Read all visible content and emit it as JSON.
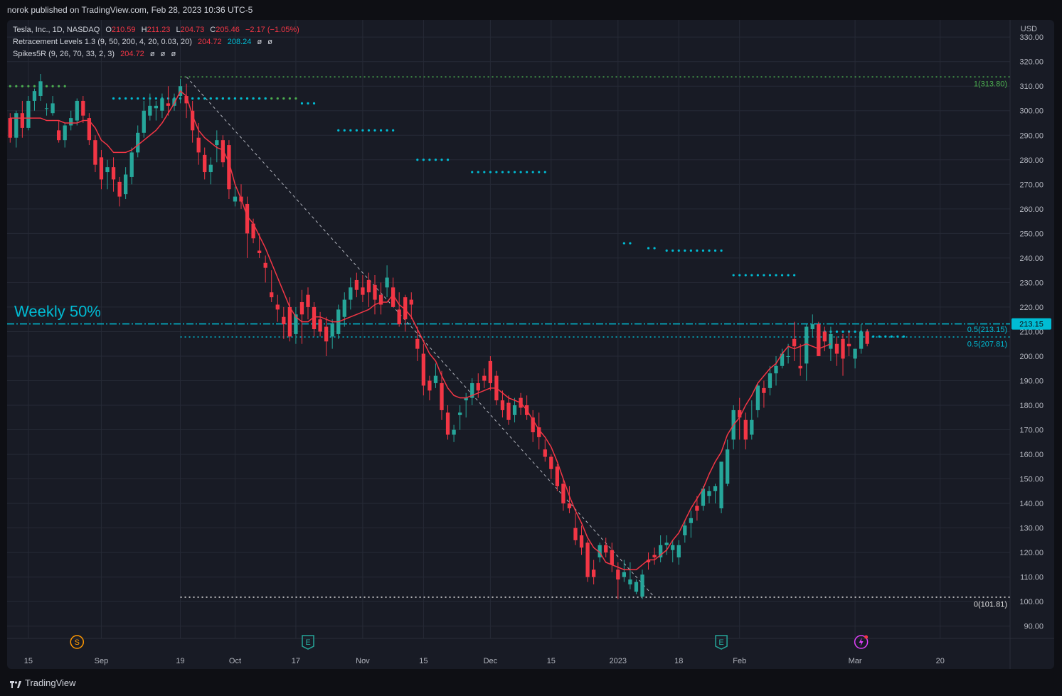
{
  "header": {
    "publish_line": "norok published on TradingView.com, Feb 28, 2023 10:36 UTC-5"
  },
  "legend": {
    "symbol": "Tesla, Inc., 1D, NASDAQ",
    "o_label": "O",
    "o_value": "210.59",
    "h_label": "H",
    "h_value": "211.23",
    "l_label": "L",
    "l_value": "204.73",
    "c_label": "C",
    "c_value": "205.46",
    "change": "−2.17 (−1.05%)",
    "ind1_name": "Retracement Levels 1.3 (9, 50, 200, 4, 20, 0.03, 20)",
    "ind1_v1": "204.72",
    "ind1_v2": "208.24",
    "ind1_v3": "ø",
    "ind1_v4": "ø",
    "ind2_name": "Spikes5R (9, 26, 70, 33, 2, 3)",
    "ind2_v1": "204.72",
    "ind2_v2": "ø",
    "ind2_v3": "ø",
    "ind2_v4": "ø"
  },
  "currency": "USD",
  "annotation": "Weekly 50%",
  "level_labels": {
    "top": "1(313.80)",
    "half_upper": "0.5(213.15)",
    "half_lower": "0.5(207.81)",
    "bottom": "0(101.81)"
  },
  "price_tag": "213.15",
  "event_markers": [
    "S",
    "E",
    "E"
  ],
  "footer": {
    "brand": "TradingView"
  },
  "colors": {
    "up": "#26a69a",
    "down": "#f23645",
    "cyan": "#00bcd4",
    "green_dots": "#4caf50",
    "bg": "#181b25",
    "grid": "#262a36",
    "text": "#b2b5be"
  },
  "chart_data": {
    "type": "candlestick",
    "title": "Tesla, Inc., 1D, NASDAQ",
    "y_axis": {
      "ticks": [
        90,
        100,
        110,
        120,
        130,
        140,
        150,
        160,
        170,
        180,
        190,
        200,
        210,
        220,
        230,
        240,
        250,
        260,
        270,
        280,
        290,
        300,
        310,
        320,
        330
      ],
      "ylim": [
        85,
        337
      ]
    },
    "x_axis": {
      "tick_labels": [
        {
          "label": "15",
          "i": 3
        },
        {
          "label": "Sep",
          "i": 15
        },
        {
          "label": "19",
          "i": 28
        },
        {
          "label": "Oct",
          "i": 37
        },
        {
          "label": "17",
          "i": 47
        },
        {
          "label": "Nov",
          "i": 58
        },
        {
          "label": "15",
          "i": 68
        },
        {
          "label": "Dec",
          "i": 79
        },
        {
          "label": "15",
          "i": 89
        },
        {
          "label": "2023",
          "i": 100
        },
        {
          "label": "18",
          "i": 110
        },
        {
          "label": "Feb",
          "i": 120
        },
        {
          "label": "Mar",
          "i": 139
        },
        {
          "label": "20",
          "i": 153
        }
      ],
      "total_slots": 165
    },
    "candles": [
      [
        297,
        299,
        287,
        289
      ],
      [
        289,
        300,
        285,
        299
      ],
      [
        299,
        304,
        289,
        293
      ],
      [
        293,
        306,
        292,
        304
      ],
      [
        304,
        309,
        300,
        308
      ],
      [
        306,
        315,
        304,
        312
      ],
      [
        301,
        303,
        298,
        301
      ],
      [
        299,
        306,
        298,
        303
      ],
      [
        292,
        296,
        287,
        288
      ],
      [
        288,
        295,
        285,
        294
      ],
      [
        294,
        300,
        292,
        297
      ],
      [
        296,
        305,
        294,
        304
      ],
      [
        304,
        306,
        295,
        298
      ],
      [
        297,
        299,
        286,
        288
      ],
      [
        288,
        290,
        275,
        278
      ],
      [
        281,
        284,
        268,
        272
      ],
      [
        275,
        280,
        268,
        277
      ],
      [
        277,
        281,
        267,
        272
      ],
      [
        271,
        273,
        261,
        265
      ],
      [
        266,
        277,
        264,
        274
      ],
      [
        273,
        285,
        270,
        283
      ],
      [
        283,
        294,
        281,
        291
      ],
      [
        291,
        304,
        289,
        300
      ],
      [
        298,
        307,
        296,
        302
      ],
      [
        301,
        304,
        296,
        302
      ],
      [
        300,
        307,
        297,
        305
      ],
      [
        303,
        310,
        298,
        302
      ],
      [
        302,
        307,
        300,
        305
      ],
      [
        306,
        313,
        303,
        310
      ],
      [
        306,
        311,
        297,
        303
      ],
      [
        300,
        304,
        287,
        292
      ],
      [
        289,
        295,
        278,
        283
      ],
      [
        282,
        285,
        272,
        275
      ],
      [
        275,
        281,
        270,
        278
      ],
      [
        286,
        292,
        279,
        288
      ],
      [
        288,
        290,
        277,
        279
      ],
      [
        286,
        288,
        264,
        268
      ],
      [
        263,
        269,
        261,
        265
      ],
      [
        265,
        270,
        260,
        263
      ],
      [
        262,
        265,
        240,
        250
      ],
      [
        254,
        256,
        246,
        248
      ],
      [
        243,
        250,
        240,
        242
      ],
      [
        238,
        241,
        230,
        236
      ],
      [
        226,
        235,
        222,
        224
      ],
      [
        221,
        225,
        214,
        219
      ],
      [
        216,
        220,
        207,
        213
      ],
      [
        220,
        224,
        206,
        208
      ],
      [
        209,
        220,
        205,
        217
      ],
      [
        222,
        227,
        205,
        217
      ],
      [
        225,
        228,
        215,
        220
      ],
      [
        220,
        222,
        208,
        211
      ],
      [
        215,
        218,
        208,
        210
      ],
      [
        212,
        216,
        200,
        206
      ],
      [
        208,
        215,
        203,
        213
      ],
      [
        209,
        221,
        207,
        219
      ],
      [
        216,
        226,
        212,
        223
      ],
      [
        223,
        232,
        219,
        228
      ],
      [
        231,
        234,
        224,
        227
      ],
      [
        228,
        233,
        222,
        225
      ],
      [
        231,
        234,
        220,
        226
      ],
      [
        229,
        233,
        217,
        223
      ],
      [
        225,
        230,
        217,
        221
      ],
      [
        228,
        237,
        224,
        232
      ],
      [
        228,
        232,
        220,
        220
      ],
      [
        219,
        226,
        212,
        213
      ],
      [
        224,
        225,
        210,
        215
      ],
      [
        223,
        226,
        215,
        221
      ],
      [
        207,
        212,
        198,
        203
      ],
      [
        201,
        205,
        184,
        188
      ],
      [
        190,
        192,
        182,
        186
      ],
      [
        189,
        197,
        187,
        192
      ],
      [
        189,
        194,
        174,
        178
      ],
      [
        177,
        180,
        166,
        168
      ],
      [
        168,
        172,
        165,
        170
      ],
      [
        176,
        180,
        170,
        177
      ],
      [
        182,
        185,
        175,
        183
      ],
      [
        183,
        191,
        180,
        189
      ],
      [
        189,
        193,
        183,
        186
      ],
      [
        192,
        195,
        187,
        190
      ],
      [
        198,
        200,
        186,
        189
      ],
      [
        192,
        194,
        180,
        182
      ],
      [
        182,
        186,
        175,
        178
      ],
      [
        181,
        184,
        172,
        174
      ],
      [
        176,
        183,
        173,
        180
      ],
      [
        183,
        185,
        176,
        179
      ],
      [
        180,
        184,
        174,
        176
      ],
      [
        175,
        178,
        165,
        169
      ],
      [
        171,
        177,
        162,
        167
      ],
      [
        162,
        166,
        157,
        159
      ],
      [
        159,
        160,
        150,
        154
      ],
      [
        155,
        156,
        145,
        147
      ],
      [
        148,
        150,
        137,
        140
      ],
      [
        140,
        147,
        136,
        138
      ],
      [
        130,
        136,
        123,
        125
      ],
      [
        127,
        131,
        119,
        122
      ],
      [
        124,
        125,
        108,
        110
      ],
      [
        113,
        117,
        107,
        110
      ],
      [
        118,
        124,
        116,
        123
      ],
      [
        123,
        126,
        118,
        120
      ],
      [
        121,
        124,
        112,
        115
      ],
      [
        113,
        116,
        101,
        109
      ],
      [
        110,
        117,
        108,
        112
      ],
      [
        107,
        116,
        105,
        109
      ],
      [
        104,
        109,
        103,
        108
      ],
      [
        102,
        113,
        101,
        111
      ],
      [
        117,
        120,
        113,
        116
      ],
      [
        119,
        122,
        115,
        118
      ],
      [
        118,
        127,
        116,
        123
      ],
      [
        123,
        127,
        119,
        124
      ],
      [
        121,
        125,
        116,
        123
      ],
      [
        118,
        125,
        115,
        123
      ],
      [
        127,
        133,
        124,
        131
      ],
      [
        132,
        137,
        126,
        134
      ],
      [
        139,
        143,
        133,
        137
      ],
      [
        139,
        147,
        137,
        146
      ],
      [
        143,
        147,
        140,
        145
      ],
      [
        145,
        148,
        140,
        147
      ],
      [
        138,
        155,
        136,
        157
      ],
      [
        148,
        166,
        147,
        162
      ],
      [
        166,
        180,
        162,
        178
      ],
      [
        178,
        183,
        166,
        175
      ],
      [
        174,
        177,
        162,
        166
      ],
      [
        168,
        182,
        166,
        174
      ],
      [
        178,
        189,
        175,
        188
      ],
      [
        187,
        190,
        179,
        185
      ],
      [
        187,
        196,
        184,
        193
      ],
      [
        193,
        200,
        188,
        196
      ],
      [
        196,
        203,
        195,
        201
      ],
      [
        200,
        205,
        197,
        200
      ],
      [
        207,
        214,
        198,
        204
      ],
      [
        196,
        205,
        192,
        195
      ],
      [
        197,
        213,
        190,
        212
      ],
      [
        211,
        217,
        208,
        213
      ],
      [
        213,
        214,
        200,
        200
      ],
      [
        210,
        212,
        202,
        206
      ],
      [
        203,
        212,
        198,
        209
      ],
      [
        205,
        208,
        196,
        201
      ],
      [
        207,
        209,
        192,
        199
      ],
      [
        205,
        210,
        200,
        204
      ],
      [
        199,
        203,
        195,
        203
      ],
      [
        203,
        213,
        201,
        210
      ],
      [
        210,
        211,
        204,
        205
      ]
    ],
    "start_slot": 0,
    "ema_line": [
      297,
      297,
      297,
      297,
      297,
      297,
      296,
      296,
      296,
      295,
      295,
      295,
      296,
      296,
      293,
      288,
      286,
      283,
      283,
      283,
      284,
      286,
      288,
      290,
      292,
      295,
      299,
      303,
      308,
      306,
      298,
      292,
      289,
      287,
      285,
      284,
      279,
      270,
      264,
      257,
      254,
      249,
      244,
      238,
      232,
      226,
      220,
      216,
      214,
      214,
      216,
      216,
      215,
      214,
      214,
      215,
      216,
      217,
      218,
      219,
      221,
      222,
      222,
      225,
      221,
      219,
      216,
      211,
      206,
      201,
      198,
      192,
      187,
      184,
      183,
      183,
      184,
      185,
      186,
      187,
      187,
      185,
      183,
      182,
      181,
      178,
      174,
      170,
      167,
      163,
      157,
      150,
      143,
      137,
      132,
      126,
      122,
      120,
      116,
      115,
      114,
      113,
      113,
      113,
      115,
      117,
      117,
      119,
      121,
      125,
      128,
      133,
      138,
      142,
      146,
      152,
      157,
      161,
      168,
      172,
      175,
      180,
      184,
      189,
      192,
      195,
      197,
      201,
      204,
      203,
      204,
      205,
      204,
      203,
      204,
      205
    ],
    "trend_line": [
      [
        29,
        313.8
      ],
      [
        106,
        101.8
      ]
    ],
    "levels": {
      "level_1": 313.8,
      "half_upper": 213.15,
      "half_lower": 207.81,
      "level_0": 101.81
    },
    "cyan_dot_rows": [
      [
        17,
        42,
        305
      ],
      [
        48,
        50,
        303
      ],
      [
        54,
        63,
        292
      ],
      [
        67,
        72,
        280
      ],
      [
        76,
        88,
        275
      ],
      [
        101,
        102,
        246
      ],
      [
        105,
        106,
        244
      ],
      [
        108,
        117,
        243
      ],
      [
        119,
        129,
        233
      ],
      [
        134,
        141,
        210
      ],
      [
        142,
        147,
        208
      ]
    ],
    "green_dot_rows": [
      [
        0,
        9,
        310
      ],
      [
        31,
        47,
        305
      ]
    ],
    "event_marker_slots": [
      11,
      49,
      117,
      140
    ]
  }
}
